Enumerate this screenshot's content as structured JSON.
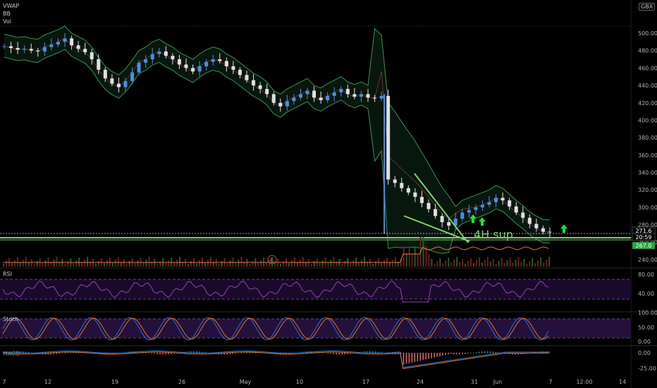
{
  "legend": {
    "vwap": "VWAP",
    "bb": "BB",
    "vol": "Vol",
    "currency": "GBX"
  },
  "panes": {
    "rsi": "RSI",
    "stoch": "Stoch",
    "macd": "MACD"
  },
  "annotations": {
    "support_text": "4H sup.",
    "earnings_marker": "E"
  },
  "price_tags": [
    {
      "label": "271.6",
      "color": "#ffffff",
      "bg": "#000000"
    },
    {
      "label": "20:59",
      "color": "#ffffff",
      "bg": "#000000"
    },
    {
      "label": "267.0",
      "color": "#ffffff",
      "bg": "#2ea043"
    }
  ],
  "colors": {
    "bull": "#4a8fe0",
    "bear": "#e0e0e0",
    "band": "#3f8f4f",
    "support": "#7bd36b",
    "arrow": "#19e03a",
    "rsi": "#9b3fb8",
    "stoch_k": "#2b6fd6",
    "stoch_d": "#e0742f"
  },
  "chart_data": [
    {
      "type": "line",
      "title": "",
      "y_axis": {
        "ticks": [
          500,
          480,
          460,
          440,
          420,
          400,
          380,
          360,
          340,
          320,
          300,
          280,
          260,
          240
        ]
      },
      "x_axis": {
        "ticks": [
          "7",
          "12",
          "19",
          "26",
          "May",
          "10",
          "17",
          "24",
          "31",
          "Jun",
          "7",
          "12:00",
          "14"
        ]
      },
      "series": [
        {
          "values": [
            485,
            483,
            481,
            482,
            480,
            479,
            484,
            487,
            490,
            494,
            486,
            482,
            478,
            470,
            458,
            448,
            442,
            438,
            445,
            455,
            466,
            470,
            476,
            479,
            474,
            470,
            464,
            460,
            456,
            462,
            467,
            470,
            468,
            462,
            458,
            452,
            446,
            440,
            436,
            430,
            420,
            416,
            422,
            426,
            430,
            434,
            426,
            423,
            428,
            432,
            436,
            430,
            427,
            430,
            426,
            425,
            428,
            332,
            328,
            322,
            317,
            312,
            305,
            298,
            290,
            283,
            279,
            287,
            294,
            297,
            300,
            303,
            306,
            311,
            308,
            301,
            294,
            288,
            281,
            276,
            272,
            271.6
          ]
        }
      ],
      "support_level": 268,
      "bollinger": true,
      "vwap": true,
      "volume": true
    },
    {
      "type": "line",
      "name": "RSI",
      "y_axis": {
        "ticks": [
          80,
          40
        ]
      },
      "bands": [
        70,
        30
      ]
    },
    {
      "type": "line",
      "name": "Stoch",
      "y_axis": {
        "ticks": [
          100,
          50,
          0
        ]
      },
      "bands": [
        80,
        20
      ]
    },
    {
      "type": "line",
      "name": "MACD",
      "y_axis": {
        "ticks": [
          0,
          -25
        ]
      }
    }
  ]
}
